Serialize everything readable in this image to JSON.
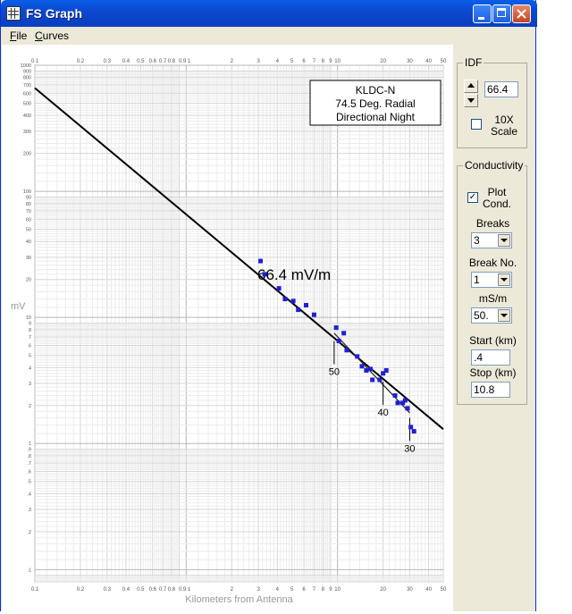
{
  "window": {
    "title": "FS Graph"
  },
  "menu": {
    "file": "File",
    "file_underline": "F",
    "file_rest": "ile",
    "curves": "Curves",
    "curves_underline": "C",
    "curves_rest": "urves"
  },
  "idf": {
    "title": "IDF",
    "value": "66.4",
    "scale_label_1": "10X",
    "scale_label_2": "Scale",
    "scale_checked": false
  },
  "conductivity": {
    "title": "Conductivity",
    "plot_cond_1": "Plot",
    "plot_cond_2": "Cond.",
    "plot_checked": true,
    "breaks_label": "Breaks",
    "breaks_value": "3",
    "break_no_label": "Break No.",
    "break_no_value": "1",
    "ms_label": "mS/m",
    "ms_value": "50.",
    "start_label": "Start (km)",
    "start_value": ".4",
    "stop_label": "Stop (km)",
    "stop_value": "10.8"
  },
  "chart_data": {
    "type": "scatter",
    "xlabel": "Kilometers from Antenna",
    "ylabel": "mV",
    "x_scale": "log",
    "y_scale": "log",
    "xlim": [
      0.1,
      50
    ],
    "ylim": [
      0.08,
      1000
    ],
    "x_ticks": [
      "0.1",
      "0.2",
      "0.3",
      "0.4",
      "0.5",
      "0.6",
      "0.7",
      "0.8",
      "0.9 1",
      "2",
      "3",
      "4",
      "5",
      "6",
      "7",
      "8",
      "9",
      "10",
      "20",
      "30",
      "40",
      "50"
    ],
    "y_ticks": [
      "1000",
      "900",
      "800",
      "700",
      "600",
      "500",
      "400",
      "300",
      "200",
      "100",
      "90",
      "80",
      "70",
      "60",
      "50",
      "40",
      "30",
      "20",
      "10",
      "9",
      "8",
      "7",
      "6",
      "5",
      "4",
      "3",
      "2",
      "1",
      ".9",
      ".8",
      ".7",
      ".6",
      ".5",
      ".4",
      ".3",
      ".2",
      ".1"
    ],
    "annotation": {
      "line1": "KLDC-N",
      "line2": "74.5 Deg. Radial",
      "line3": "Directional Night"
    },
    "curve_label": "66.4 mV/m",
    "curve": [
      {
        "x": 0.1,
        "y": 660
      },
      {
        "x": 50,
        "y": 1.3
      }
    ],
    "conductivity_marks": [
      {
        "label": "50",
        "x": 9.5
      },
      {
        "label": "40",
        "x": 20
      },
      {
        "label": "30",
        "x": 30
      }
    ],
    "points": [
      {
        "x": 3.1,
        "y": 28
      },
      {
        "x": 3.3,
        "y": 22
      },
      {
        "x": 4.1,
        "y": 17
      },
      {
        "x": 4.5,
        "y": 14
      },
      {
        "x": 5.1,
        "y": 13.5
      },
      {
        "x": 5.5,
        "y": 11.5
      },
      {
        "x": 6.2,
        "y": 12.5
      },
      {
        "x": 7.0,
        "y": 10.5
      },
      {
        "x": 9.8,
        "y": 8.3
      },
      {
        "x": 10.2,
        "y": 6.5
      },
      {
        "x": 11.0,
        "y": 7.5
      },
      {
        "x": 11.5,
        "y": 5.5
      },
      {
        "x": 13.5,
        "y": 4.9
      },
      {
        "x": 14.5,
        "y": 4.1
      },
      {
        "x": 15.5,
        "y": 3.8
      },
      {
        "x": 16.5,
        "y": 3.9
      },
      {
        "x": 17.0,
        "y": 3.2
      },
      {
        "x": 19.0,
        "y": 3.2
      },
      {
        "x": 20.0,
        "y": 3.6
      },
      {
        "x": 21.0,
        "y": 3.8
      },
      {
        "x": 24.0,
        "y": 2.4
      },
      {
        "x": 25.0,
        "y": 2.1
      },
      {
        "x": 27.0,
        "y": 2.1
      },
      {
        "x": 28.0,
        "y": 2.2
      },
      {
        "x": 29.0,
        "y": 1.9
      },
      {
        "x": 30.5,
        "y": 1.35
      },
      {
        "x": 32.0,
        "y": 1.25
      }
    ]
  }
}
